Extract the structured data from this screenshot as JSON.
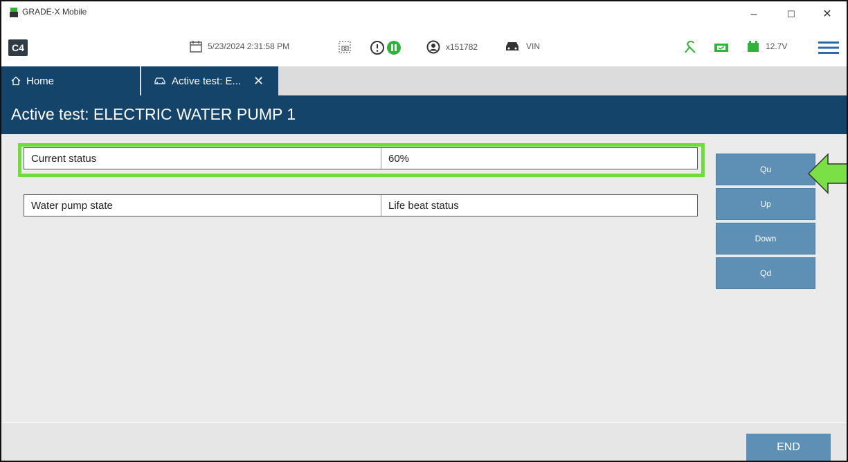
{
  "window": {
    "title": "GRADE-X Mobile",
    "minimize": "–",
    "maximize": "☐",
    "close": "✕"
  },
  "toolbar": {
    "logo": "C4",
    "datetime": "5/23/2024 2:31:58 PM",
    "user_id": "x151782",
    "vin_label": "VIN",
    "battery_voltage": "12.7V",
    "status_color": "#2fb33d"
  },
  "tabs": [
    {
      "label": "Home",
      "icon": "home-icon"
    },
    {
      "label": "Active test: E...",
      "icon": "car-icon",
      "close": "✕"
    }
  ],
  "page": {
    "title": "Active test: ELECTRIC WATER PUMP 1"
  },
  "table": [
    {
      "name": "Current status",
      "value": "60%"
    },
    {
      "name": "Water pump state",
      "value": "Life beat status"
    }
  ],
  "side_buttons": [
    "Qu",
    "Up",
    "Down",
    "Qd"
  ],
  "footer": {
    "end_label": "END"
  },
  "colors": {
    "header_bg": "#14446a",
    "button_bg": "#5e8fb4",
    "highlight": "#6fdc3d"
  }
}
